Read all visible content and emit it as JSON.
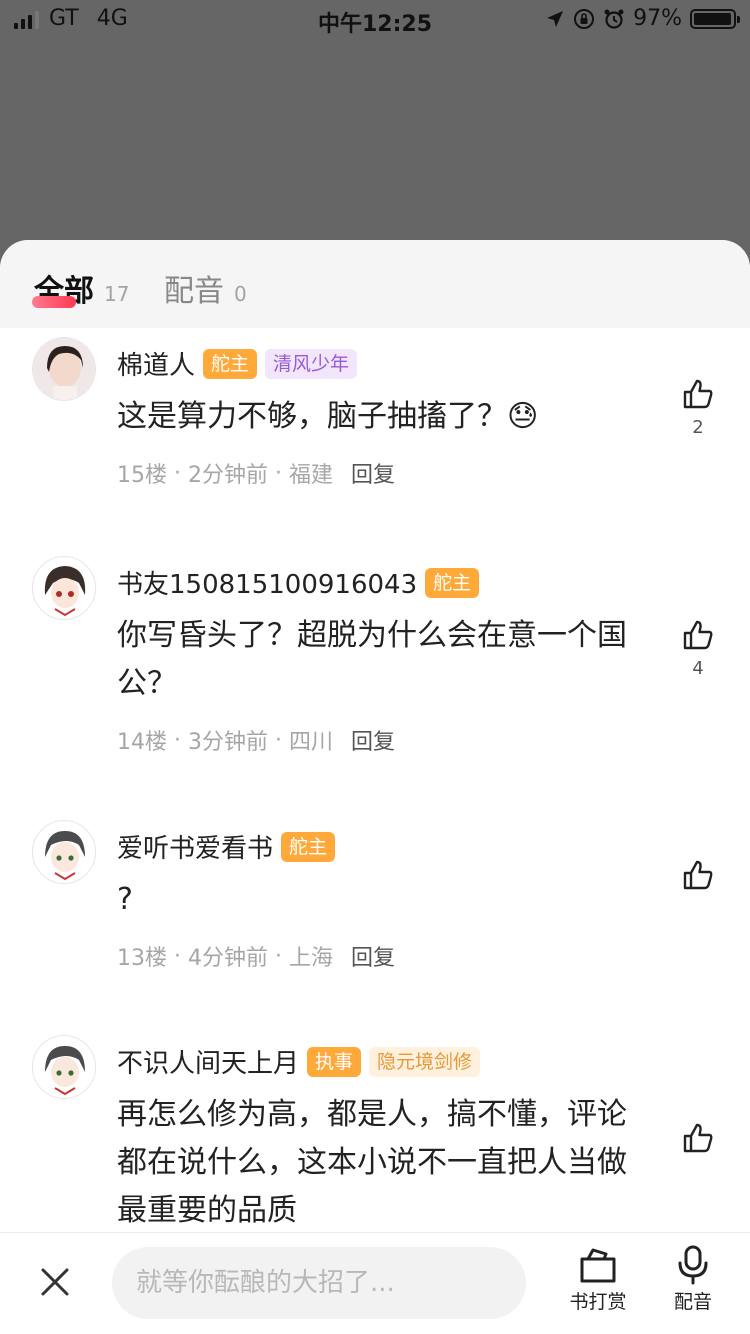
{
  "status_bar": {
    "carrier": "GT",
    "network": "4G",
    "time": "中午12:25",
    "battery": "97%",
    "battery_level": 0.97
  },
  "tabs": [
    {
      "label": "全部",
      "count": "17"
    },
    {
      "label": "配音",
      "count": "0"
    }
  ],
  "comments": [
    {
      "name": "棉道人",
      "badges": [
        "舵主",
        "清风少年"
      ],
      "text": "这是算力不够，脑子抽搐了？😓",
      "floor": "15楼",
      "time": "2分钟前",
      "location": "福建",
      "reply": "回复",
      "likes": "2"
    },
    {
      "name": "书友150815100916043",
      "badges": [
        "舵主"
      ],
      "text": "你写昏头了？超脱为什么会在意一个国公？",
      "floor": "14楼",
      "time": "3分钟前",
      "location": "四川",
      "reply": "回复",
      "likes": "4"
    },
    {
      "name": "爱听书爱看书",
      "badges": [
        "舵主"
      ],
      "text": "?",
      "floor": "13楼",
      "time": "4分钟前",
      "location": "上海",
      "reply": "回复",
      "likes": ""
    },
    {
      "name": "不识人间天上月",
      "badges": [
        "执事",
        "隐元境剑修"
      ],
      "text": "再怎么修为高，都是人，搞不懂，评论都在说什么，这本小说不一直把人当做最重要的品质",
      "likes": ""
    }
  ],
  "bottom_bar": {
    "input_placeholder": "就等你酝酿的大招了...",
    "tip_label": "书打赏",
    "dub_label": "配音"
  },
  "icons": [
    "signal-icon",
    "location-arrow-icon",
    "rotation-lock-icon",
    "alarm-icon",
    "battery-icon",
    "thumbs-up-icon",
    "close-icon",
    "gift-box-icon",
    "microphone-icon"
  ],
  "colors": {
    "accent_badge": "#ffa93a",
    "tab_underline": "#ff3a52",
    "backdrop": "#666666"
  }
}
